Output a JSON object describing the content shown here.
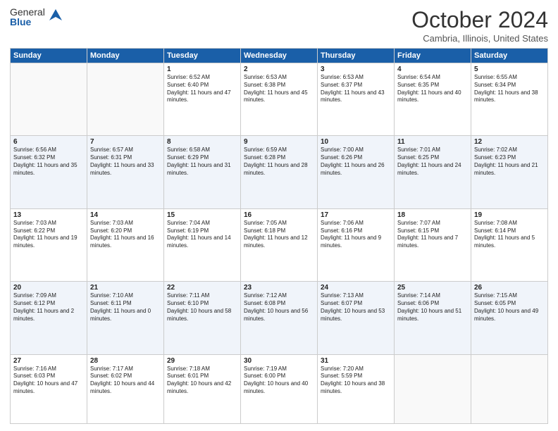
{
  "logo": {
    "general": "General",
    "blue": "Blue"
  },
  "title": "October 2024",
  "subtitle": "Cambria, Illinois, United States",
  "days": [
    "Sunday",
    "Monday",
    "Tuesday",
    "Wednesday",
    "Thursday",
    "Friday",
    "Saturday"
  ],
  "weeks": [
    [
      {
        "day": "",
        "content": ""
      },
      {
        "day": "",
        "content": ""
      },
      {
        "day": "1",
        "content": "Sunrise: 6:52 AM\nSunset: 6:40 PM\nDaylight: 11 hours and 47 minutes."
      },
      {
        "day": "2",
        "content": "Sunrise: 6:53 AM\nSunset: 6:38 PM\nDaylight: 11 hours and 45 minutes."
      },
      {
        "day": "3",
        "content": "Sunrise: 6:53 AM\nSunset: 6:37 PM\nDaylight: 11 hours and 43 minutes."
      },
      {
        "day": "4",
        "content": "Sunrise: 6:54 AM\nSunset: 6:35 PM\nDaylight: 11 hours and 40 minutes."
      },
      {
        "day": "5",
        "content": "Sunrise: 6:55 AM\nSunset: 6:34 PM\nDaylight: 11 hours and 38 minutes."
      }
    ],
    [
      {
        "day": "6",
        "content": "Sunrise: 6:56 AM\nSunset: 6:32 PM\nDaylight: 11 hours and 35 minutes."
      },
      {
        "day": "7",
        "content": "Sunrise: 6:57 AM\nSunset: 6:31 PM\nDaylight: 11 hours and 33 minutes."
      },
      {
        "day": "8",
        "content": "Sunrise: 6:58 AM\nSunset: 6:29 PM\nDaylight: 11 hours and 31 minutes."
      },
      {
        "day": "9",
        "content": "Sunrise: 6:59 AM\nSunset: 6:28 PM\nDaylight: 11 hours and 28 minutes."
      },
      {
        "day": "10",
        "content": "Sunrise: 7:00 AM\nSunset: 6:26 PM\nDaylight: 11 hours and 26 minutes."
      },
      {
        "day": "11",
        "content": "Sunrise: 7:01 AM\nSunset: 6:25 PM\nDaylight: 11 hours and 24 minutes."
      },
      {
        "day": "12",
        "content": "Sunrise: 7:02 AM\nSunset: 6:23 PM\nDaylight: 11 hours and 21 minutes."
      }
    ],
    [
      {
        "day": "13",
        "content": "Sunrise: 7:03 AM\nSunset: 6:22 PM\nDaylight: 11 hours and 19 minutes."
      },
      {
        "day": "14",
        "content": "Sunrise: 7:03 AM\nSunset: 6:20 PM\nDaylight: 11 hours and 16 minutes."
      },
      {
        "day": "15",
        "content": "Sunrise: 7:04 AM\nSunset: 6:19 PM\nDaylight: 11 hours and 14 minutes."
      },
      {
        "day": "16",
        "content": "Sunrise: 7:05 AM\nSunset: 6:18 PM\nDaylight: 11 hours and 12 minutes."
      },
      {
        "day": "17",
        "content": "Sunrise: 7:06 AM\nSunset: 6:16 PM\nDaylight: 11 hours and 9 minutes."
      },
      {
        "day": "18",
        "content": "Sunrise: 7:07 AM\nSunset: 6:15 PM\nDaylight: 11 hours and 7 minutes."
      },
      {
        "day": "19",
        "content": "Sunrise: 7:08 AM\nSunset: 6:14 PM\nDaylight: 11 hours and 5 minutes."
      }
    ],
    [
      {
        "day": "20",
        "content": "Sunrise: 7:09 AM\nSunset: 6:12 PM\nDaylight: 11 hours and 2 minutes."
      },
      {
        "day": "21",
        "content": "Sunrise: 7:10 AM\nSunset: 6:11 PM\nDaylight: 11 hours and 0 minutes."
      },
      {
        "day": "22",
        "content": "Sunrise: 7:11 AM\nSunset: 6:10 PM\nDaylight: 10 hours and 58 minutes."
      },
      {
        "day": "23",
        "content": "Sunrise: 7:12 AM\nSunset: 6:08 PM\nDaylight: 10 hours and 56 minutes."
      },
      {
        "day": "24",
        "content": "Sunrise: 7:13 AM\nSunset: 6:07 PM\nDaylight: 10 hours and 53 minutes."
      },
      {
        "day": "25",
        "content": "Sunrise: 7:14 AM\nSunset: 6:06 PM\nDaylight: 10 hours and 51 minutes."
      },
      {
        "day": "26",
        "content": "Sunrise: 7:15 AM\nSunset: 6:05 PM\nDaylight: 10 hours and 49 minutes."
      }
    ],
    [
      {
        "day": "27",
        "content": "Sunrise: 7:16 AM\nSunset: 6:03 PM\nDaylight: 10 hours and 47 minutes."
      },
      {
        "day": "28",
        "content": "Sunrise: 7:17 AM\nSunset: 6:02 PM\nDaylight: 10 hours and 44 minutes."
      },
      {
        "day": "29",
        "content": "Sunrise: 7:18 AM\nSunset: 6:01 PM\nDaylight: 10 hours and 42 minutes."
      },
      {
        "day": "30",
        "content": "Sunrise: 7:19 AM\nSunset: 6:00 PM\nDaylight: 10 hours and 40 minutes."
      },
      {
        "day": "31",
        "content": "Sunrise: 7:20 AM\nSunset: 5:59 PM\nDaylight: 10 hours and 38 minutes."
      },
      {
        "day": "",
        "content": ""
      },
      {
        "day": "",
        "content": ""
      }
    ]
  ]
}
